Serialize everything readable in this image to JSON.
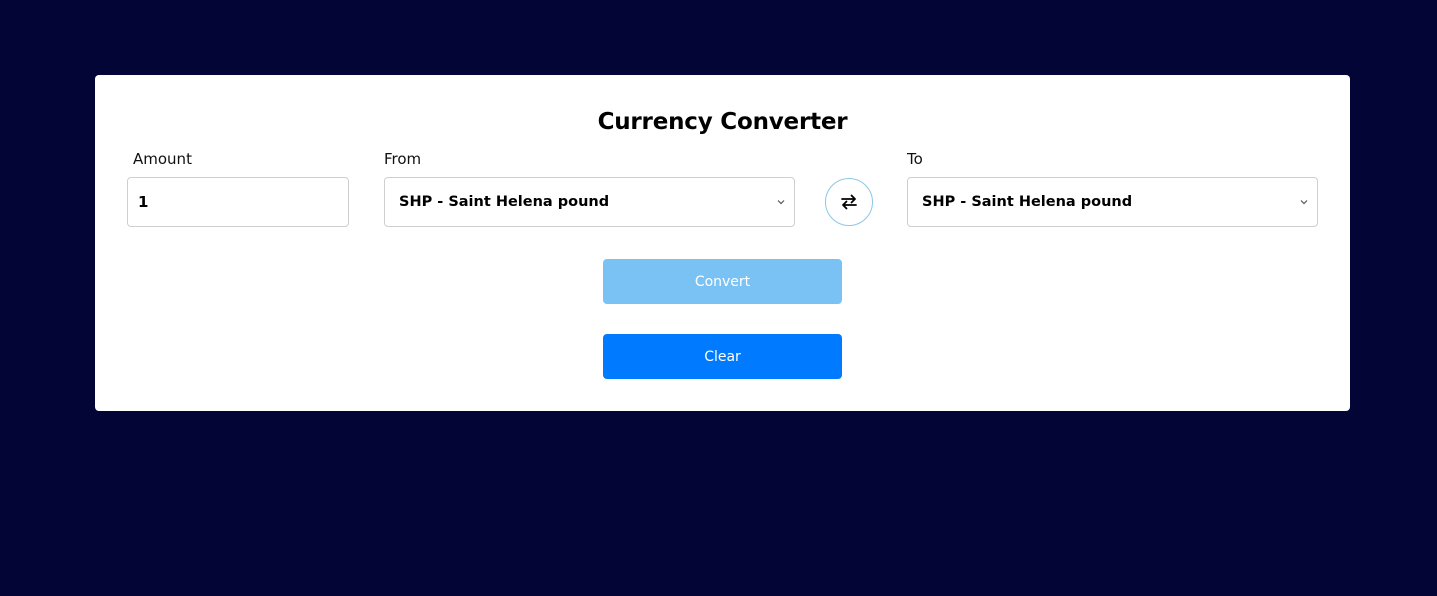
{
  "app": {
    "title": "Currency Converter"
  },
  "form": {
    "amount_label": "Amount",
    "amount_value": "1",
    "from_label": "From",
    "from_selected": "SHP - Saint Helena pound",
    "to_label": "To",
    "to_selected": "SHP - Saint Helena pound"
  },
  "actions": {
    "convert_label": "Convert",
    "clear_label": "Clear"
  },
  "icons": {
    "swap": "swap-arrows-icon",
    "dropdown": "chevron-down-icon"
  },
  "colors": {
    "background": "#020535",
    "card": "#ffffff",
    "convert_button": "#7bc2f4",
    "clear_button": "#007bff",
    "swap_border": "#8cc7e6"
  }
}
